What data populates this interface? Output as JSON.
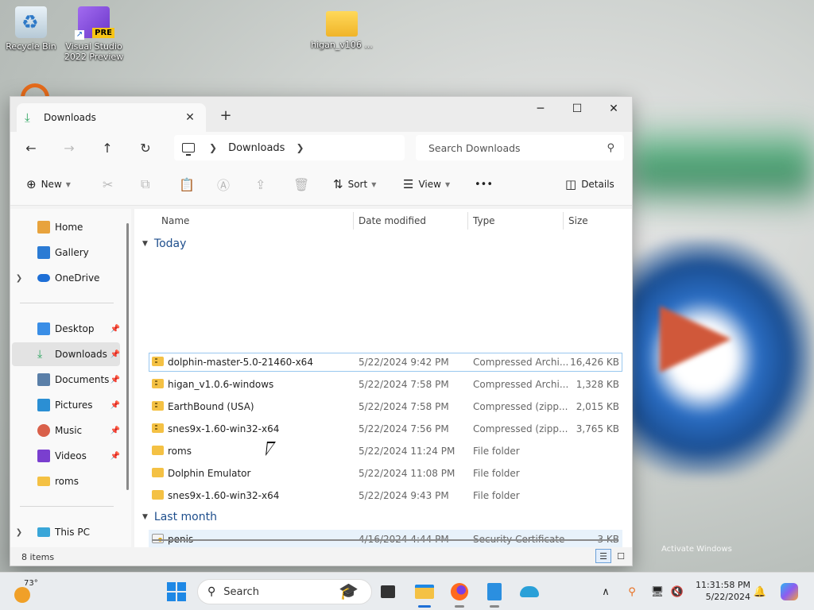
{
  "desktop": {
    "icons": [
      {
        "label": "Recycle Bin"
      },
      {
        "label": "Visual Studio 2022 Preview",
        "badge": "PRE"
      },
      {
        "label": "higan_v106 ..."
      }
    ],
    "watermark": "Activate Windows"
  },
  "window": {
    "tab_title": "Downloads",
    "controls": {
      "minimize": "─",
      "maximize": "☐",
      "close": "✕"
    },
    "nav": {
      "back": "←",
      "forward": "→",
      "up": "↑",
      "refresh": "↻"
    },
    "breadcrumb": [
      "Downloads"
    ],
    "search_placeholder": "Search Downloads",
    "toolbar": {
      "new_label": "New",
      "sort_label": "Sort",
      "view_label": "View",
      "more_label": "•••",
      "details_label": "Details"
    },
    "sidebar": {
      "top": [
        {
          "label": "Home",
          "icon": "home-icon",
          "color": "#e8a33d"
        },
        {
          "label": "Gallery",
          "icon": "gallery-icon",
          "color": "#2b7bd4"
        },
        {
          "label": "OneDrive",
          "icon": "cloud-icon",
          "color": "#1e6fd6"
        }
      ],
      "quick": [
        {
          "label": "Desktop",
          "icon": "desktop-icon",
          "color": "#3a8ee6",
          "pinned": true
        },
        {
          "label": "Downloads",
          "icon": "download-icon",
          "color": "#2aa35e",
          "pinned": true,
          "selected": true
        },
        {
          "label": "Documents",
          "icon": "documents-icon",
          "color": "#5a7fa8",
          "pinned": true
        },
        {
          "label": "Pictures",
          "icon": "pictures-icon",
          "color": "#2b8fd4",
          "pinned": true
        },
        {
          "label": "Music",
          "icon": "music-icon",
          "color": "#d9604a",
          "pinned": true
        },
        {
          "label": "Videos",
          "icon": "videos-icon",
          "color": "#7a3fcf",
          "pinned": true
        },
        {
          "label": "roms",
          "icon": "folder-icon",
          "color": "#f4c144",
          "pinned": false
        }
      ],
      "bottom": [
        {
          "label": "This PC",
          "icon": "pc-icon",
          "color": "#3aa6d8"
        }
      ],
      "pin_glyph": "📌"
    },
    "columns": [
      "Name",
      "Date modified",
      "Type",
      "Size"
    ],
    "groups": [
      {
        "label": "Today",
        "files": [
          {
            "name": "dolphin-master-5.0-21460-x64",
            "date": "5/22/2024 9:42 PM",
            "type": "Compressed Archi...",
            "size": "16,426 KB",
            "kind": "zip"
          },
          {
            "name": "higan_v1.0.6-windows",
            "date": "5/22/2024 7:58 PM",
            "type": "Compressed Archi...",
            "size": "1,328 KB",
            "kind": "zip"
          },
          {
            "name": "EarthBound (USA)",
            "date": "5/22/2024 7:58 PM",
            "type": "Compressed (zipp...",
            "size": "2,015 KB",
            "kind": "zip"
          },
          {
            "name": "snes9x-1.60-win32-x64",
            "date": "5/22/2024 7:56 PM",
            "type": "Compressed (zipp...",
            "size": "3,765 KB",
            "kind": "zip"
          },
          {
            "name": "roms",
            "date": "5/22/2024 11:24 PM",
            "type": "File folder",
            "size": "",
            "kind": "folder"
          },
          {
            "name": "Dolphin Emulator",
            "date": "5/22/2024 11:08 PM",
            "type": "File folder",
            "size": "",
            "kind": "folder"
          },
          {
            "name": "snes9x-1.60-win32-x64",
            "date": "5/22/2024 9:43 PM",
            "type": "File folder",
            "size": "",
            "kind": "folder"
          }
        ]
      },
      {
        "label": "Last month",
        "files": [
          {
            "name": "penis",
            "date": "4/16/2024 4:44 PM",
            "type": "Security Certificate",
            "size": "3 KB",
            "kind": "cert"
          }
        ]
      }
    ],
    "status": "8 items"
  },
  "taskbar": {
    "temperature": "73°",
    "search_placeholder": "Search",
    "time": "11:31:58 PM",
    "date": "5/22/2024"
  }
}
